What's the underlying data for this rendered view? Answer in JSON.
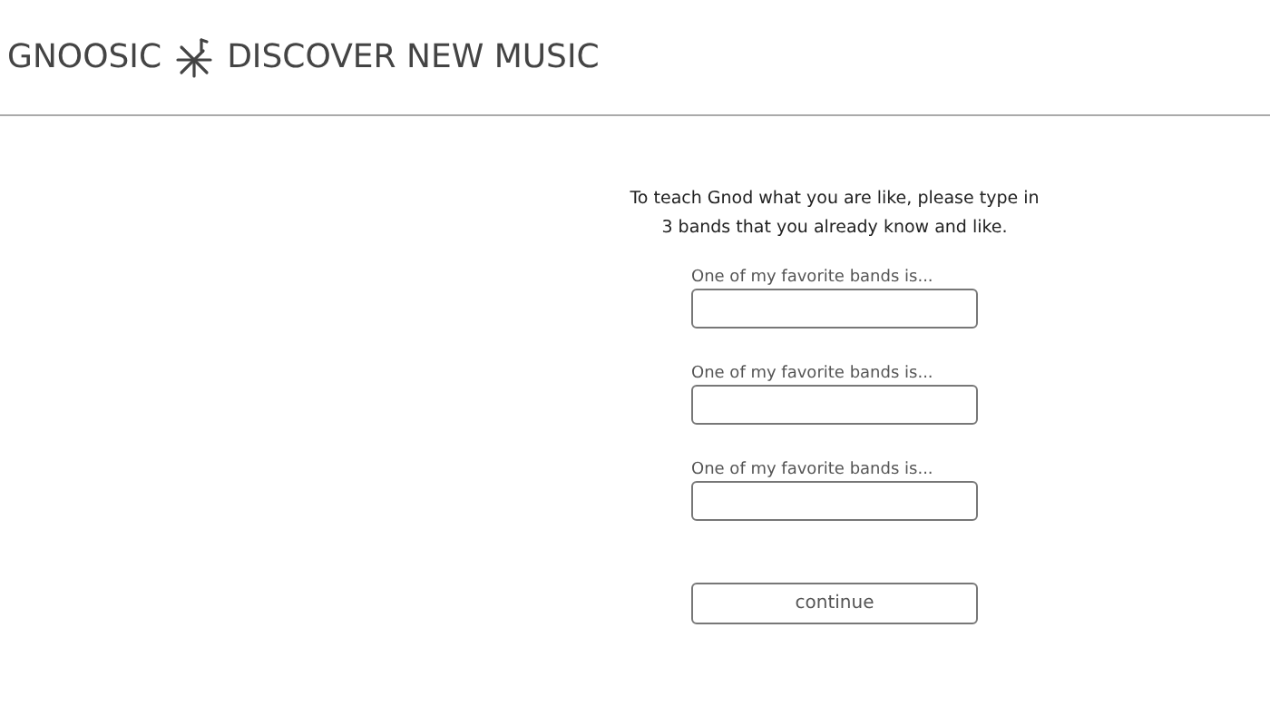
{
  "header": {
    "brand": "GNOOSIC",
    "tagline": "DISCOVER NEW MUSIC"
  },
  "intro": "To teach Gnod what you are like, please type in 3 bands that you already know and like.",
  "fields": [
    {
      "label": "One of my favorite bands is..."
    },
    {
      "label": "One of my favorite bands is..."
    },
    {
      "label": "One of my favorite bands is..."
    }
  ],
  "button": "continue"
}
